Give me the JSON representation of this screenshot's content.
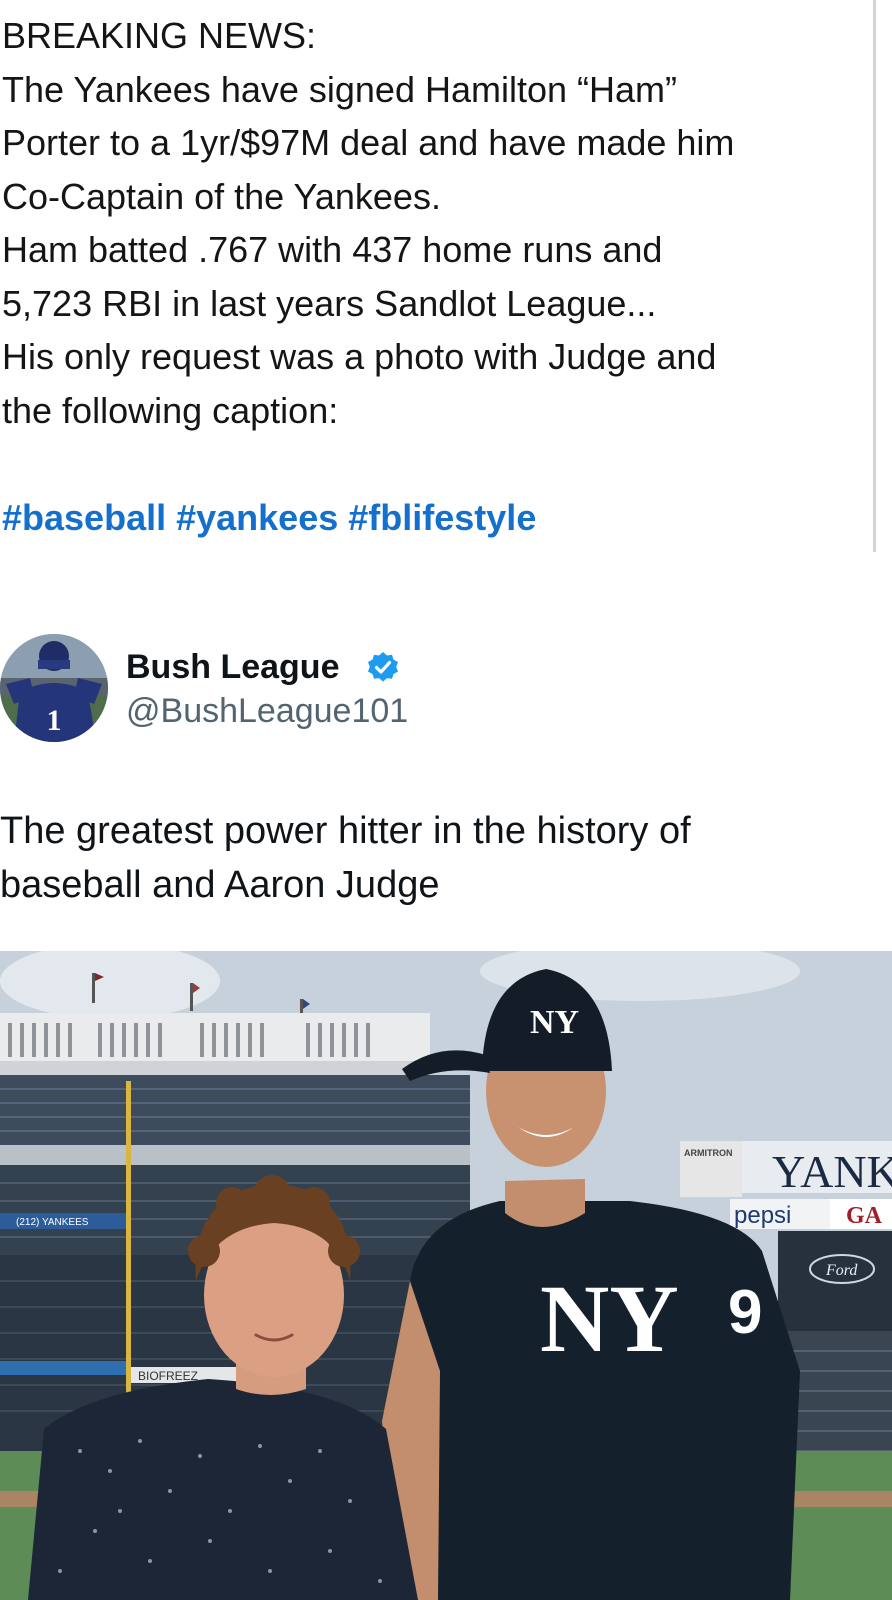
{
  "post": {
    "lines": [
      "BREAKING NEWS:",
      "The Yankees have signed Hamilton “Ham”",
      "Porter to a 1yr/$97M deal and have made him",
      "Co-Captain of the Yankees.",
      "Ham batted .767 with 437 home runs and",
      "5,723 RBI in last years Sandlot League...",
      "His only request was a photo with Judge and",
      "the following caption:"
    ],
    "hashtags": [
      "#baseball",
      "#yankees",
      "#fblifestyle"
    ]
  },
  "tweet": {
    "author_name": "Bush League",
    "author_handle": "@BushLeague101",
    "avatar_number": "1",
    "text_lines": [
      "The greatest power hitter in the history of",
      "baseball and Aaron Judge"
    ]
  },
  "photo": {
    "signs": {
      "armitron": "ARMITRON",
      "yankees": "YANK",
      "pepsi": "pepsi",
      "gate": "GA",
      "ford": "Ford",
      "biofreeze": "BIOFREEZ",
      "ticket_phone": "(212) YANKEES"
    },
    "jersey_number": "9",
    "logo": "NY"
  },
  "colors": {
    "hashtag": "#1470cc",
    "verified": "#1d9bf0",
    "handle": "#536471",
    "sky": "#c6d0db",
    "grass": "#5f8d58",
    "navy": "#16202e"
  }
}
